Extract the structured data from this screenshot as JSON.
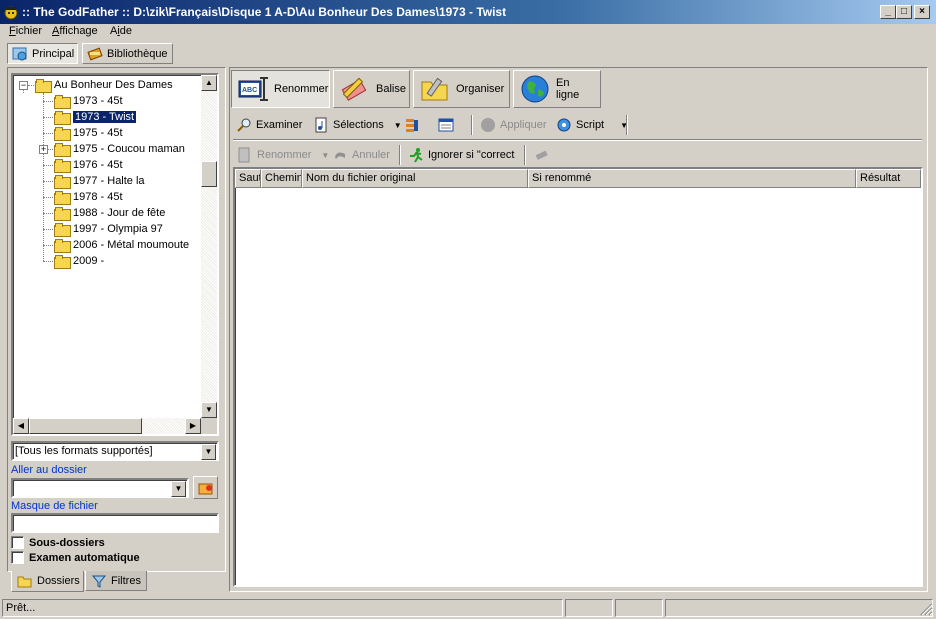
{
  "window": {
    "title": ":: The GodFather ::  D:\\zik\\Français\\Disque 1 A-D\\Au Bonheur Des Dames\\1973 - Twist",
    "buttons": {
      "minimize": "_",
      "maximize": "□",
      "close": "×"
    }
  },
  "menubar": {
    "items": [
      {
        "label": "Fichier",
        "accel": "F"
      },
      {
        "label": "Affichage",
        "accel": "A"
      },
      {
        "label": "Aide",
        "accel": "i"
      }
    ]
  },
  "top_tabs": [
    {
      "label": "Principal",
      "active": true,
      "icon": "globe-icon"
    },
    {
      "label": "Bibliothèque",
      "active": false,
      "icon": "books-icon"
    }
  ],
  "tree": {
    "root": "Au Bonheur Des Dames",
    "items": [
      {
        "label": "1973 - 45t",
        "selected": false,
        "expandable": false
      },
      {
        "label": "1973 - Twist",
        "selected": true,
        "expandable": false
      },
      {
        "label": "1975 - 45t",
        "selected": false,
        "expandable": false
      },
      {
        "label": "1975 - Coucou maman",
        "selected": false,
        "expandable": true
      },
      {
        "label": "1976 - 45t",
        "selected": false,
        "expandable": false
      },
      {
        "label": "1977 - Halte la",
        "selected": false,
        "expandable": false
      },
      {
        "label": "1978 - 45t",
        "selected": false,
        "expandable": false
      },
      {
        "label": "1988 - Jour de fête",
        "selected": false,
        "expandable": false
      },
      {
        "label": "1997 - Olympia 97",
        "selected": false,
        "expandable": false
      },
      {
        "label": "2006 - Métal moumoute",
        "selected": false,
        "expandable": false
      },
      {
        "label": "2009 -",
        "selected": false,
        "expandable": false
      }
    ]
  },
  "left_panel": {
    "format_filter": "[Tous les formats supportés]",
    "goto_folder_label": "Aller au dossier",
    "goto_folder_value": "",
    "file_mask_label": "Masque de fichier",
    "file_mask_value": "",
    "subfolders_label": "Sous-dossiers",
    "subfolders_checked": false,
    "auto_scan_label": "Examen automatique",
    "auto_scan_checked": false,
    "bottom_tabs": [
      {
        "label": "Dossiers",
        "active": true,
        "icon": "folder-icon"
      },
      {
        "label": "Filtres",
        "active": false,
        "icon": "funnel-icon"
      }
    ]
  },
  "modes": [
    {
      "label": "Renommer",
      "active": true,
      "icon": "rename-abc-icon"
    },
    {
      "label": "Balise",
      "active": false,
      "icon": "tag-pencil-icon"
    },
    {
      "label": "Organiser",
      "active": false,
      "icon": "folder-organize-icon"
    },
    {
      "label": "En ligne",
      "active": false,
      "icon": "earth-globe-icon"
    }
  ],
  "toolbar1": {
    "examine": "Examiner",
    "selections": "Sélections",
    "apply": "Appliquer",
    "script": "Script"
  },
  "toolbar2": {
    "rename": "Renommer",
    "undo": "Annuler",
    "ignore": "Ignorer si \"correct"
  },
  "grid": {
    "columns": [
      "Saut",
      "Chemin",
      "Nom du fichier original",
      "Si renommé",
      "Résultat"
    ],
    "rows": []
  },
  "status": {
    "text": "Prêt..."
  },
  "colors": {
    "titlebar_start": "#0a246a",
    "titlebar_end": "#a6caf0",
    "selection": "#0a246a",
    "link": "#0033cc",
    "face": "#d4d0c8"
  }
}
